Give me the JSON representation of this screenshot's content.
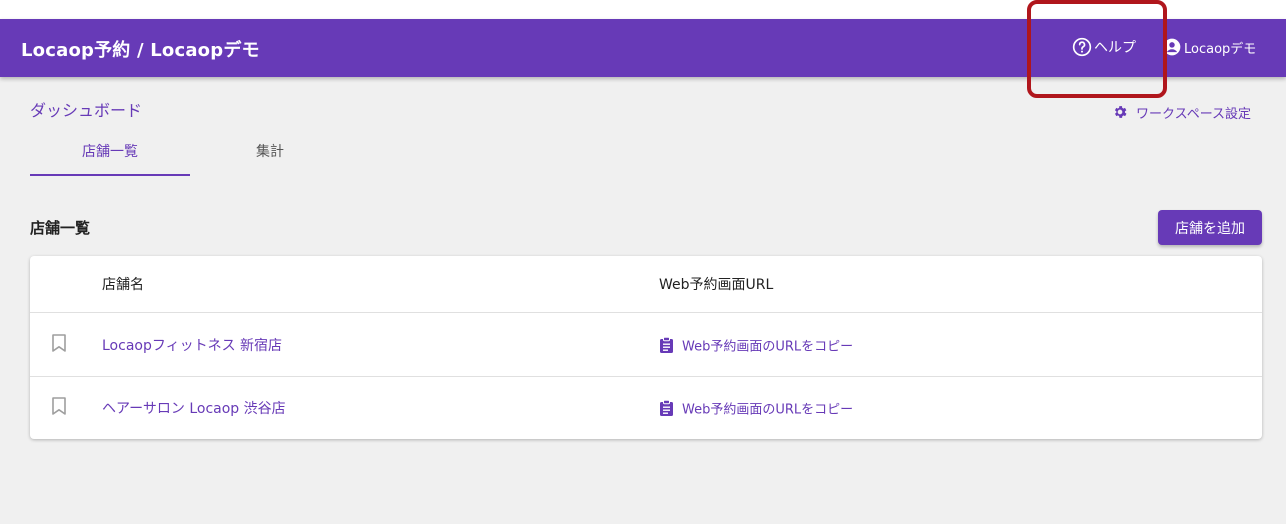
{
  "app": {
    "title": "Locaop予約 / Locaopデモ",
    "help_label": "ヘルプ",
    "account_label": "Locaopデモ"
  },
  "icons": {
    "help": "help-circle-icon",
    "account": "account-circle-icon",
    "settings": "gear-icon",
    "bookmark": "bookmark-outline-icon",
    "clipboard": "clipboard-icon"
  },
  "colors": {
    "primary": "#673ab7",
    "highlight": "#b0161c"
  },
  "page": {
    "heading": "ダッシュボード",
    "workspace_settings": "ワークスペース設定"
  },
  "tabs": [
    {
      "label": "店舗一覧",
      "active": true
    },
    {
      "label": "集計",
      "active": false
    }
  ],
  "section": {
    "title": "店舗一覧",
    "add_button": "店舗を追加"
  },
  "table": {
    "columns": [
      "店舗名",
      "Web予約画面URL"
    ],
    "rows": [
      {
        "name": "Locaopフィットネス 新宿店",
        "url_action": "Web予約画面のURLをコピー"
      },
      {
        "name": "ヘアーサロン Locaop 渋谷店",
        "url_action": "Web予約画面のURLをコピー"
      }
    ]
  }
}
